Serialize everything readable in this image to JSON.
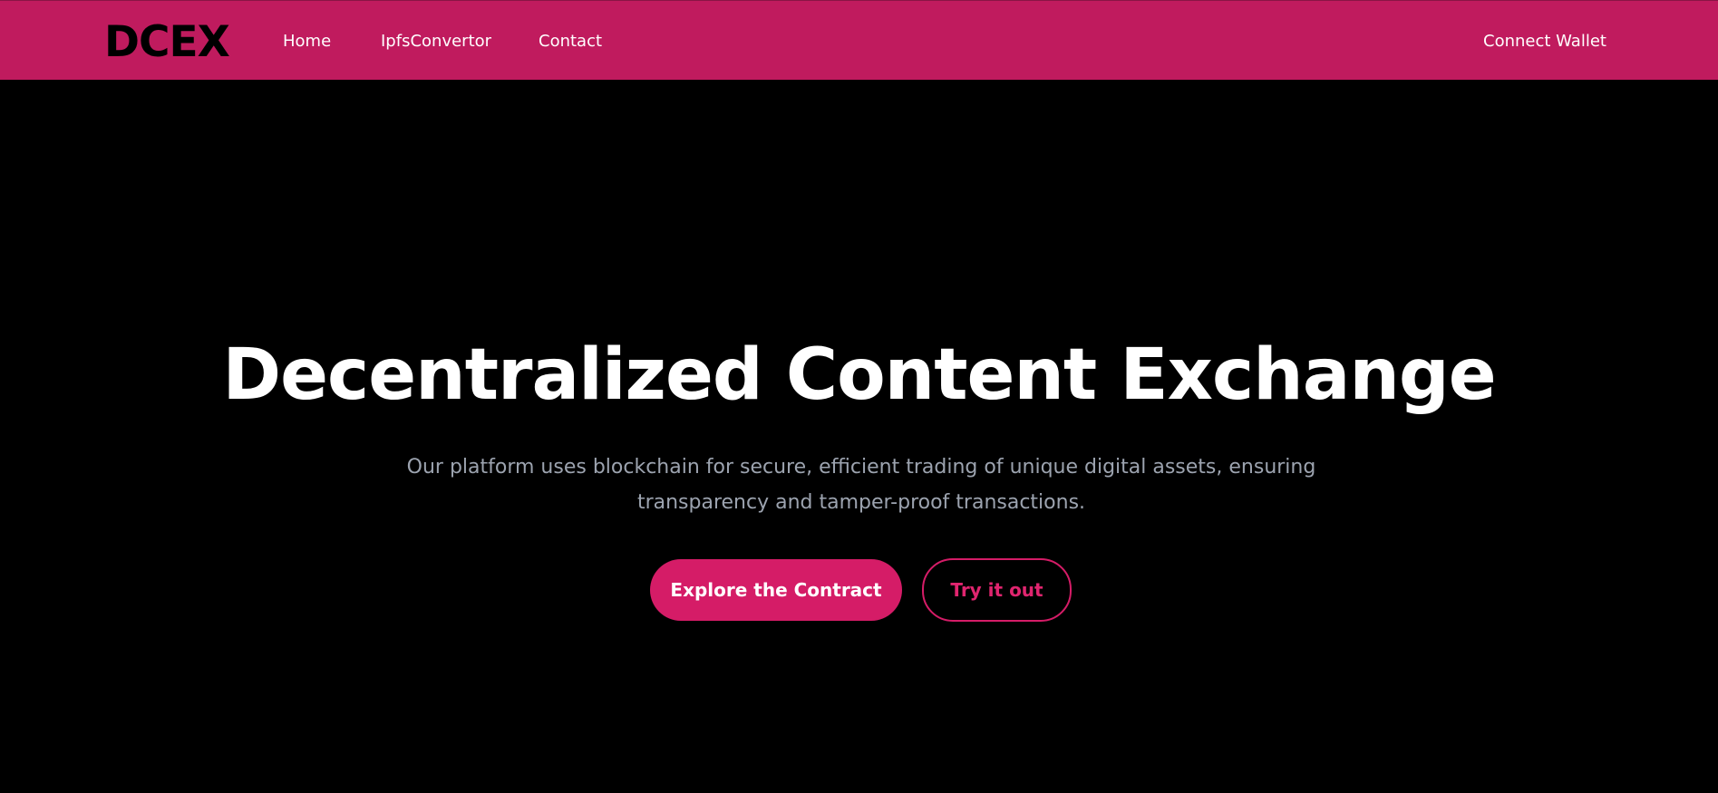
{
  "navbar": {
    "logo": "DCEX",
    "links": [
      {
        "label": "Home"
      },
      {
        "label": "IpfsConvertor"
      },
      {
        "label": "Contact"
      }
    ],
    "wallet_label": "Connect Wallet",
    "background_color": "#c01b5e"
  },
  "hero": {
    "title": "Decentralized Content Exchange",
    "subtitle": "Our platform uses blockchain for secure, efficient trading of unique digital assets, ensuring transparency and tamper-proof transactions.",
    "primary_button": "Explore the Contract",
    "secondary_button": "Try it out",
    "accent_color": "#d51c67"
  }
}
